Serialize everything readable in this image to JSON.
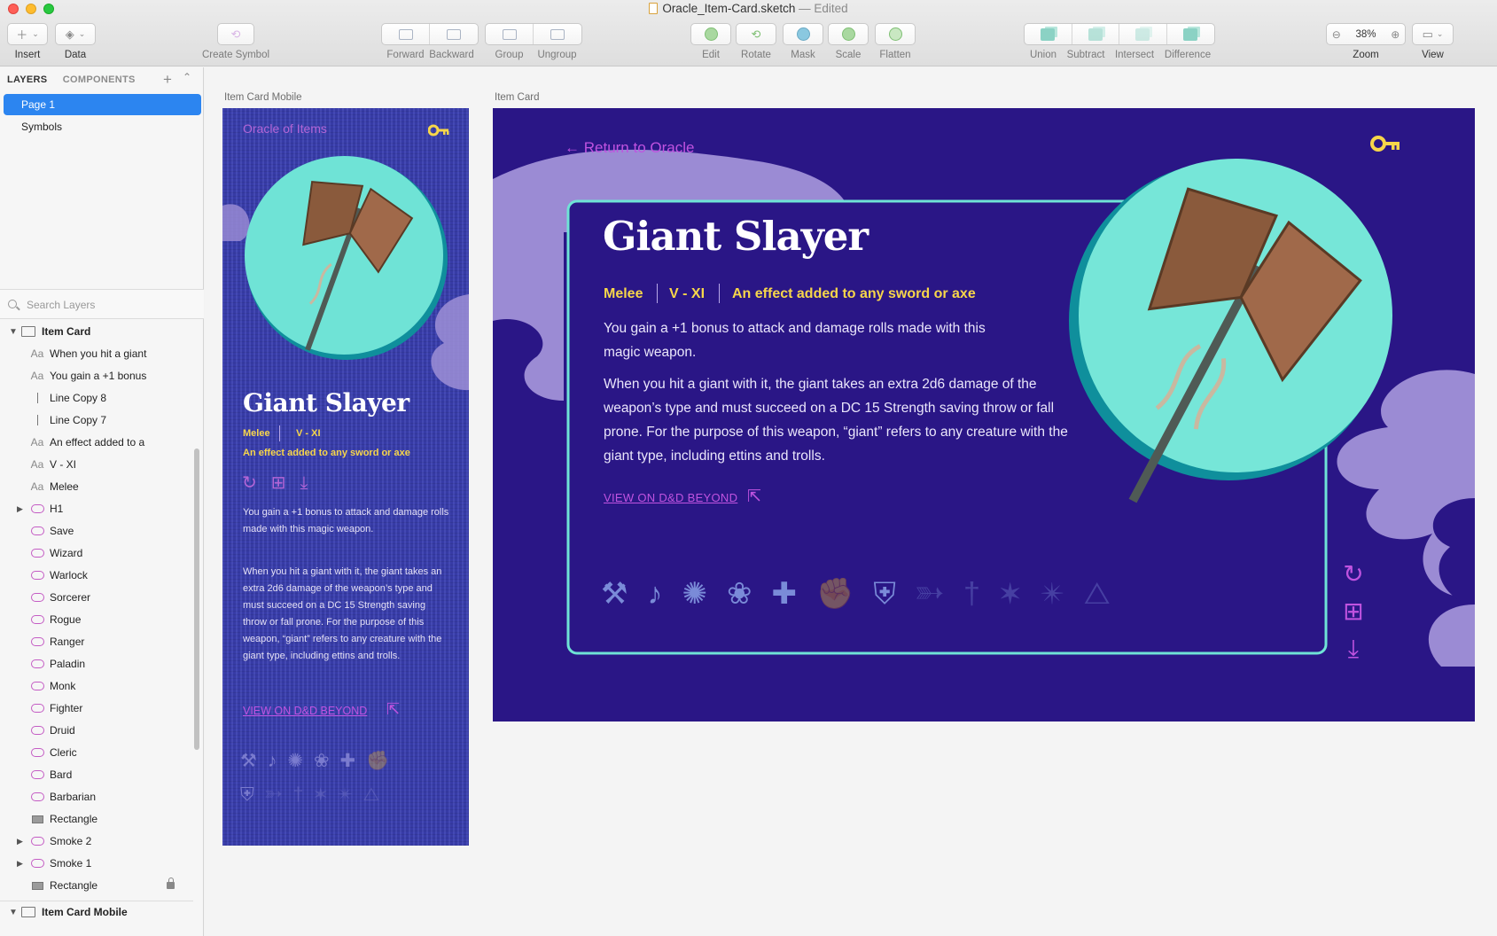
{
  "window": {
    "title": "Oracle_Item-Card.sketch",
    "status": "— Edited"
  },
  "toolbar": {
    "insert": "Insert",
    "data": "Data",
    "create_symbol": "Create Symbol",
    "forward": "Forward",
    "backward": "Backward",
    "group": "Group",
    "ungroup": "Ungroup",
    "edit": "Edit",
    "rotate": "Rotate",
    "mask": "Mask",
    "scale": "Scale",
    "flatten": "Flatten",
    "union": "Union",
    "subtract": "Subtract",
    "intersect": "Intersect",
    "difference": "Difference",
    "zoom_value": "38%",
    "zoom": "Zoom",
    "view": "View"
  },
  "sidebar": {
    "tab_layers": "LAYERS",
    "tab_components": "COMPONENTS",
    "pages": [
      "Page 1",
      "Symbols"
    ],
    "search_placeholder": "Search Layers",
    "layers": [
      {
        "name": "Item Card",
        "type": "artboard"
      },
      {
        "name": "When you hit a giant",
        "type": "text"
      },
      {
        "name": "You gain a +1 bonus",
        "type": "text"
      },
      {
        "name": "Line Copy 8",
        "type": "line"
      },
      {
        "name": "Line Copy 7",
        "type": "line"
      },
      {
        "name": "An effect added to a",
        "type": "text"
      },
      {
        "name": "V - XI",
        "type": "text"
      },
      {
        "name": "Melee",
        "type": "text"
      },
      {
        "name": "H1",
        "type": "symbol"
      },
      {
        "name": "Save",
        "type": "symbol"
      },
      {
        "name": "Wizard",
        "type": "symbol"
      },
      {
        "name": "Warlock",
        "type": "symbol"
      },
      {
        "name": "Sorcerer",
        "type": "symbol"
      },
      {
        "name": "Rogue",
        "type": "symbol"
      },
      {
        "name": "Ranger",
        "type": "symbol"
      },
      {
        "name": "Paladin",
        "type": "symbol"
      },
      {
        "name": "Monk",
        "type": "symbol"
      },
      {
        "name": "Fighter",
        "type": "symbol"
      },
      {
        "name": "Druid",
        "type": "symbol"
      },
      {
        "name": "Cleric",
        "type": "symbol"
      },
      {
        "name": "Bard",
        "type": "symbol"
      },
      {
        "name": "Barbarian",
        "type": "symbol"
      },
      {
        "name": "Rectangle",
        "type": "rect"
      },
      {
        "name": "Smoke 2",
        "type": "symbol"
      },
      {
        "name": "Smoke 1",
        "type": "symbol"
      },
      {
        "name": "Rectangle",
        "type": "rect"
      },
      {
        "name": "Item Card Mobile",
        "type": "artboard"
      }
    ]
  },
  "canvas": {
    "mobile_label": "Item Card Mobile",
    "desktop_label": "Item Card"
  },
  "mobile_card": {
    "header": "Oracle of Items",
    "title": "Giant Slayer",
    "type": "Melee",
    "tier": "V - XI",
    "effect": "An effect added to any sword or axe",
    "para1": "You gain a +1 bonus to attack and damage rolls made with this magic weapon.",
    "para2": "When you hit a giant with it, the giant takes an extra 2d6 damage of the weapon’s type and must succeed on a DC 15 Strength saving throw or fall prone. For the purpose of this weapon, “giant” refers to any creature with the giant type, including ettins and trolls.",
    "link": "VIEW ON D&D BEYOND"
  },
  "desktop_card": {
    "back_link": "Return to Oracle",
    "title": "Giant Slayer",
    "type": "Melee",
    "tier": "V - XI",
    "effect": "An effect added to any sword or axe",
    "para1": "You gain a +1 bonus to attack and damage rolls made with this magic weapon.",
    "para2": "When you hit a giant with it, the giant takes an extra 2d6 damage of the weapon’s type and must succeed on a DC 15 Strength saving throw or fall prone. For the purpose of this weapon, “giant” refers to any creature with the giant type, including ettins and trolls.",
    "link": "VIEW ON D&D BEYOND"
  },
  "colors": {
    "accent": "#2c85f0",
    "card_bg": "#2a1686",
    "teal": "#7ae8d9",
    "gold": "#f7d64a",
    "link": "#c053e0"
  }
}
